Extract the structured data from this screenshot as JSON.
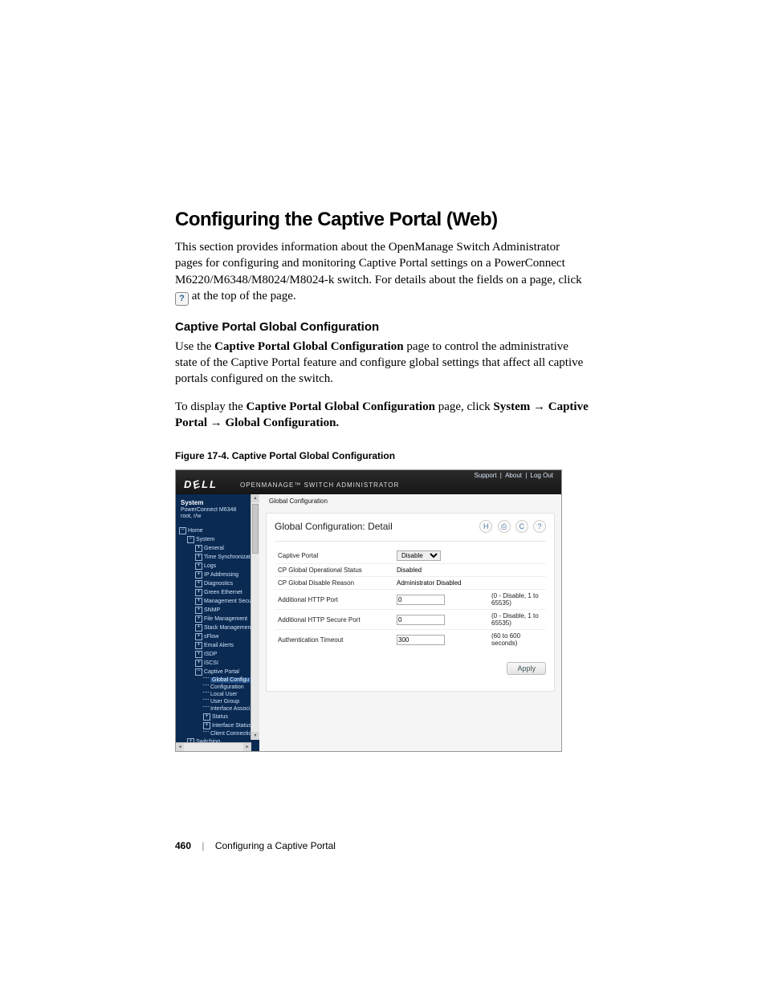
{
  "heading": "Configuring the Captive Portal (Web)",
  "intro_p1_a": "This section provides information about the OpenManage Switch Administrator pages for configuring and monitoring Captive Portal settings on a PowerConnect M6220/M6348/M8024/M8024-k switch. For details about the fields on a page, click ",
  "intro_p1_b": " at the top of the page.",
  "subhead": "Captive Portal Global Configuration",
  "p2_a": "Use the ",
  "p2_b": "Captive Portal Global Configuration",
  "p2_c": " page to control the administrative state of the Captive Portal feature and configure global settings that affect all captive portals configured on the switch.",
  "p3_a": "To display the ",
  "p3_b": "Captive Portal Global Configuration",
  "p3_c": " page, click ",
  "p3_d": "System",
  "p3_e": " → ",
  "p3_f": "Captive Portal",
  "p3_g": " → ",
  "p3_h": "Global Configuration.",
  "figcap": "Figure 17-4.    Captive Portal Global Configuration",
  "shot": {
    "toplinks": {
      "support": "Support",
      "about": "About",
      "logout": "Log Out"
    },
    "brand": "DELL",
    "product": "OPENMANAGE™ SWITCH ADMINISTRATOR",
    "side": {
      "sys": "System",
      "model": "PowerConnect M6348",
      "user": "root, r/w",
      "tree": {
        "home": "Home",
        "system": "System",
        "items": [
          "General",
          "Time Synchronization",
          "Logs",
          "IP Addressing",
          "Diagnostics",
          "Green Ethernet",
          "Management Security",
          "SNMP",
          "File Management",
          "Stack Management",
          "sFlow",
          "Email Alerts",
          "ISDP",
          "iSCSI",
          "Captive Portal"
        ],
        "cp_children": [
          "Global Configu",
          "Configuration",
          "Local User",
          "User Group",
          "Interface Associ",
          "Status",
          "Interface Status",
          "Client Connectio"
        ],
        "switching": "Switching"
      }
    },
    "crumb": "Global Configuration",
    "panel": {
      "title": "Global Configuration: Detail",
      "rows": [
        {
          "label": "Captive Portal",
          "type": "select",
          "value": "Disable",
          "hint": ""
        },
        {
          "label": "CP Global Operational Status",
          "type": "text",
          "value": "Disabled",
          "hint": ""
        },
        {
          "label": "CP Global Disable Reason",
          "type": "text",
          "value": "Administrator Disabled",
          "hint": ""
        },
        {
          "label": "Additional HTTP Port",
          "type": "input",
          "value": "0",
          "hint": "(0 - Disable, 1 to 65535)"
        },
        {
          "label": "Additional HTTP Secure Port",
          "type": "input",
          "value": "0",
          "hint": "(0 - Disable, 1 to 65535)"
        },
        {
          "label": "Authentication Timeout",
          "type": "input",
          "value": "300",
          "hint": "(60 to 600 seconds)"
        }
      ],
      "apply": "Apply"
    }
  },
  "footer": {
    "page": "460",
    "chapter": "Configuring a Captive Portal"
  }
}
